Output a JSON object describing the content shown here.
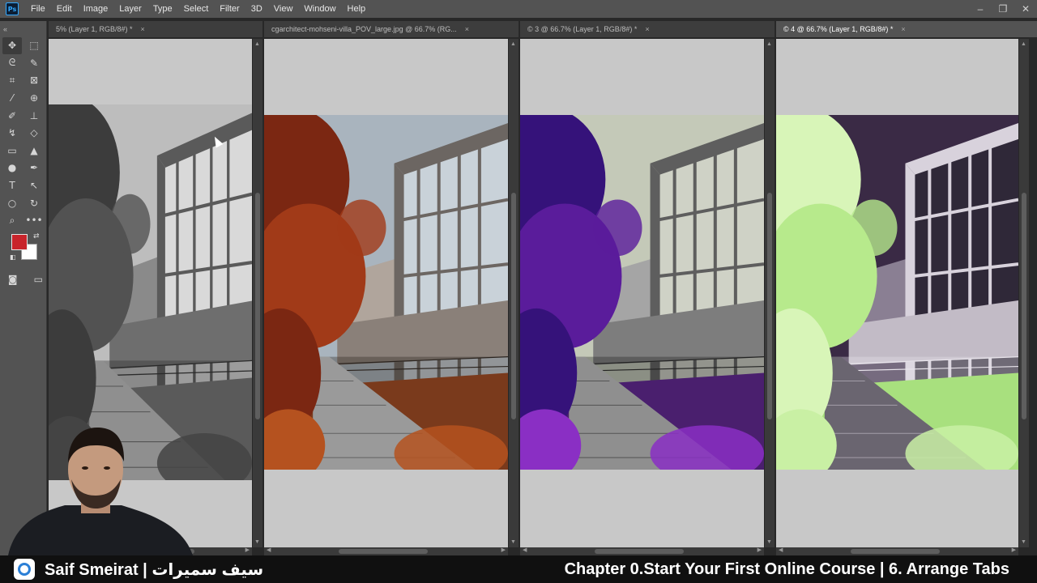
{
  "menu": [
    "File",
    "Edit",
    "Image",
    "Layer",
    "Type",
    "Select",
    "Filter",
    "3D",
    "View",
    "Window",
    "Help"
  ],
  "app_logo": "Ps",
  "window_controls": [
    "–",
    "❐",
    "✕"
  ],
  "tabs": [
    {
      "label": "5% (Layer 1, RGB/8#) *"
    },
    {
      "label": "cgarchitect-mohseni-villa_POV_large.jpg @ 66.7% (RG..."
    },
    {
      "label": "© 3 @ 66.7% (Layer 1, RGB/8#) *"
    },
    {
      "label": "© 4 @ 66.7% (Layer 1, RGB/8#) *"
    }
  ],
  "tab_close_glyph": "×",
  "toolbar_grip": "«",
  "tools": [
    {
      "icon": "move-icon",
      "glyph": "✥"
    },
    {
      "icon": "marquee-icon",
      "glyph": "⬚"
    },
    {
      "icon": "lasso-icon",
      "glyph": "ᘓ"
    },
    {
      "icon": "quick-select-icon",
      "glyph": "✎"
    },
    {
      "icon": "crop-icon",
      "glyph": "⌗"
    },
    {
      "icon": "frame-icon",
      "glyph": "⊠"
    },
    {
      "icon": "eyedropper-icon",
      "glyph": "⁄"
    },
    {
      "icon": "healing-icon",
      "glyph": "⊕"
    },
    {
      "icon": "brush-icon",
      "glyph": "✐"
    },
    {
      "icon": "stamp-icon",
      "glyph": "⊥"
    },
    {
      "icon": "history-brush-icon",
      "glyph": "↯"
    },
    {
      "icon": "eraser-icon",
      "glyph": "◇"
    },
    {
      "icon": "gradient-icon",
      "glyph": "▭"
    },
    {
      "icon": "blur-icon",
      "glyph": "▲"
    },
    {
      "icon": "dodge-icon",
      "glyph": "●"
    },
    {
      "icon": "pen-icon",
      "glyph": "✒"
    },
    {
      "icon": "type-icon",
      "glyph": "T"
    },
    {
      "icon": "path-select-icon",
      "glyph": "↖"
    },
    {
      "icon": "ellipse-icon",
      "glyph": "○"
    },
    {
      "icon": "rotate-view-icon",
      "glyph": "↻"
    },
    {
      "icon": "zoom-icon",
      "glyph": "⌕"
    },
    {
      "icon": "more-tools-icon",
      "glyph": "•••"
    }
  ],
  "colors": {
    "foreground": "#c8242b",
    "background": "#ffffff"
  },
  "caption": {
    "presenter": "Saif Smeirat | سيف سميرات",
    "chapter": "Chapter 0.Start Your First Online Course | 6. Arrange Tabs"
  }
}
